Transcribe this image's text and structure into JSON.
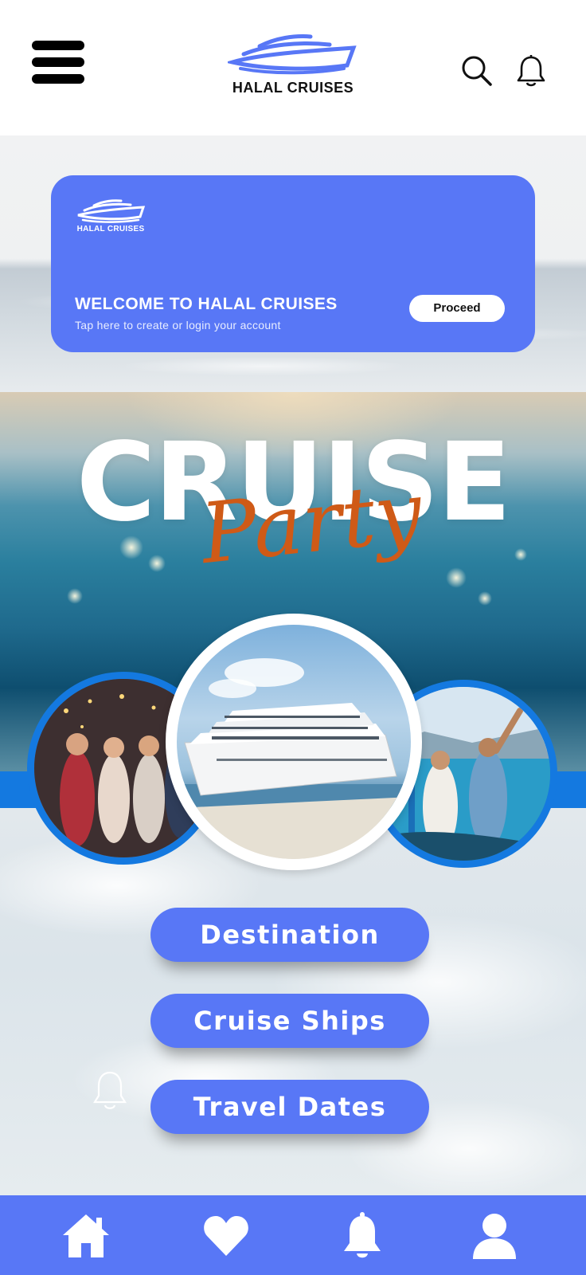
{
  "header": {
    "brand": "HALAL CRUISES",
    "menu_icon": "hamburger-menu-icon",
    "search_icon": "search-icon",
    "notification_icon": "bell-icon"
  },
  "welcome_card": {
    "brand": "HALAL CRUISES",
    "title": "WELCOME TO HALAL CRUISES",
    "subtitle": "Tap here to create or login your account",
    "proceed_label": "Proceed"
  },
  "hero": {
    "title": "CRUISE",
    "script": "Party"
  },
  "menu_buttons": [
    {
      "label": "Destination"
    },
    {
      "label": "Cruise Ships"
    },
    {
      "label": "Travel Dates"
    }
  ],
  "bottom_nav": [
    {
      "icon": "home-icon"
    },
    {
      "icon": "heart-icon"
    },
    {
      "icon": "bell-icon"
    },
    {
      "icon": "user-icon"
    }
  ],
  "colors": {
    "accent": "#5877f6",
    "strip_blue": "#1479e0",
    "script_orange": "#cf5a17"
  }
}
